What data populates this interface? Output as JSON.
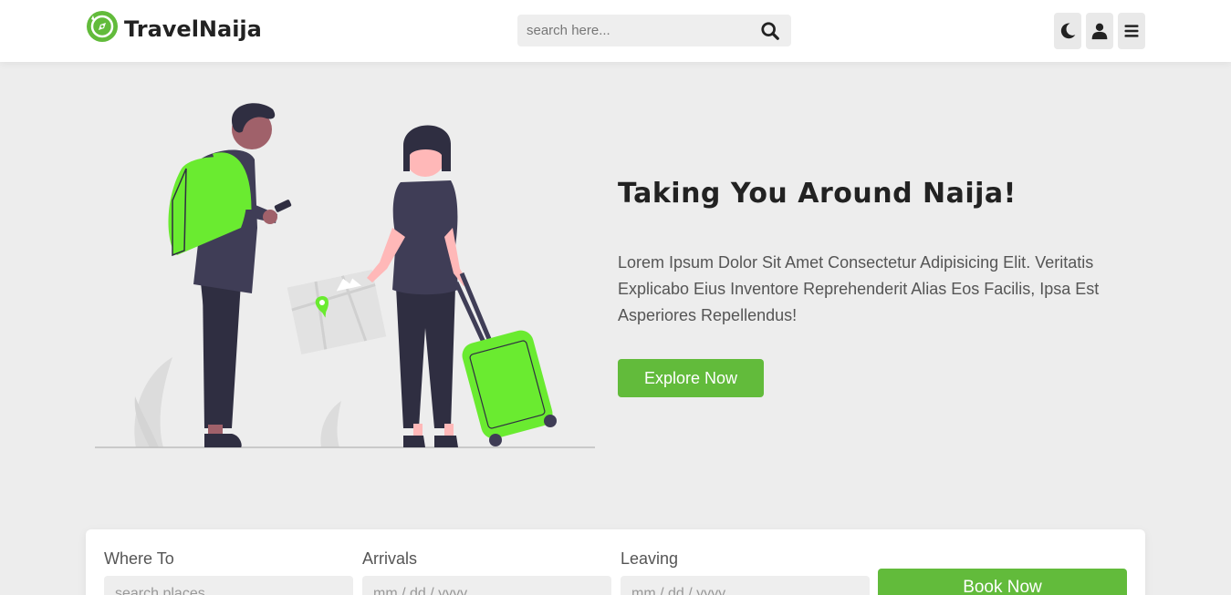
{
  "header": {
    "brand": "TravelNaija",
    "search_placeholder": "search here...",
    "icons": [
      "compass-icon",
      "search-icon",
      "moon-icon",
      "user-icon",
      "menu-icon"
    ]
  },
  "hero": {
    "title": "Taking You Around Naija!",
    "text": "Lorem Ipsum Dolor Sit Amet Consectetur Adipisicing Elit. Veritatis Explicabo Eius Inventore Reprehenderit Alias Eos Facilis, Ipsa Est Asperiores Repellendus!",
    "cta_label": "Explore Now"
  },
  "booking": {
    "where_label": "Where To",
    "where_placeholder": "search places",
    "arrivals_label": "Arrivals",
    "arrivals_placeholder": "mm / dd / yyyy",
    "leaving_label": "Leaving",
    "leaving_placeholder": "mm / dd / yyyy",
    "book_label": "Book Now"
  },
  "colors": {
    "accent": "#62bb3b",
    "bright_green": "#6aeb30",
    "dark": "#222222",
    "page_bg": "#ededed"
  }
}
